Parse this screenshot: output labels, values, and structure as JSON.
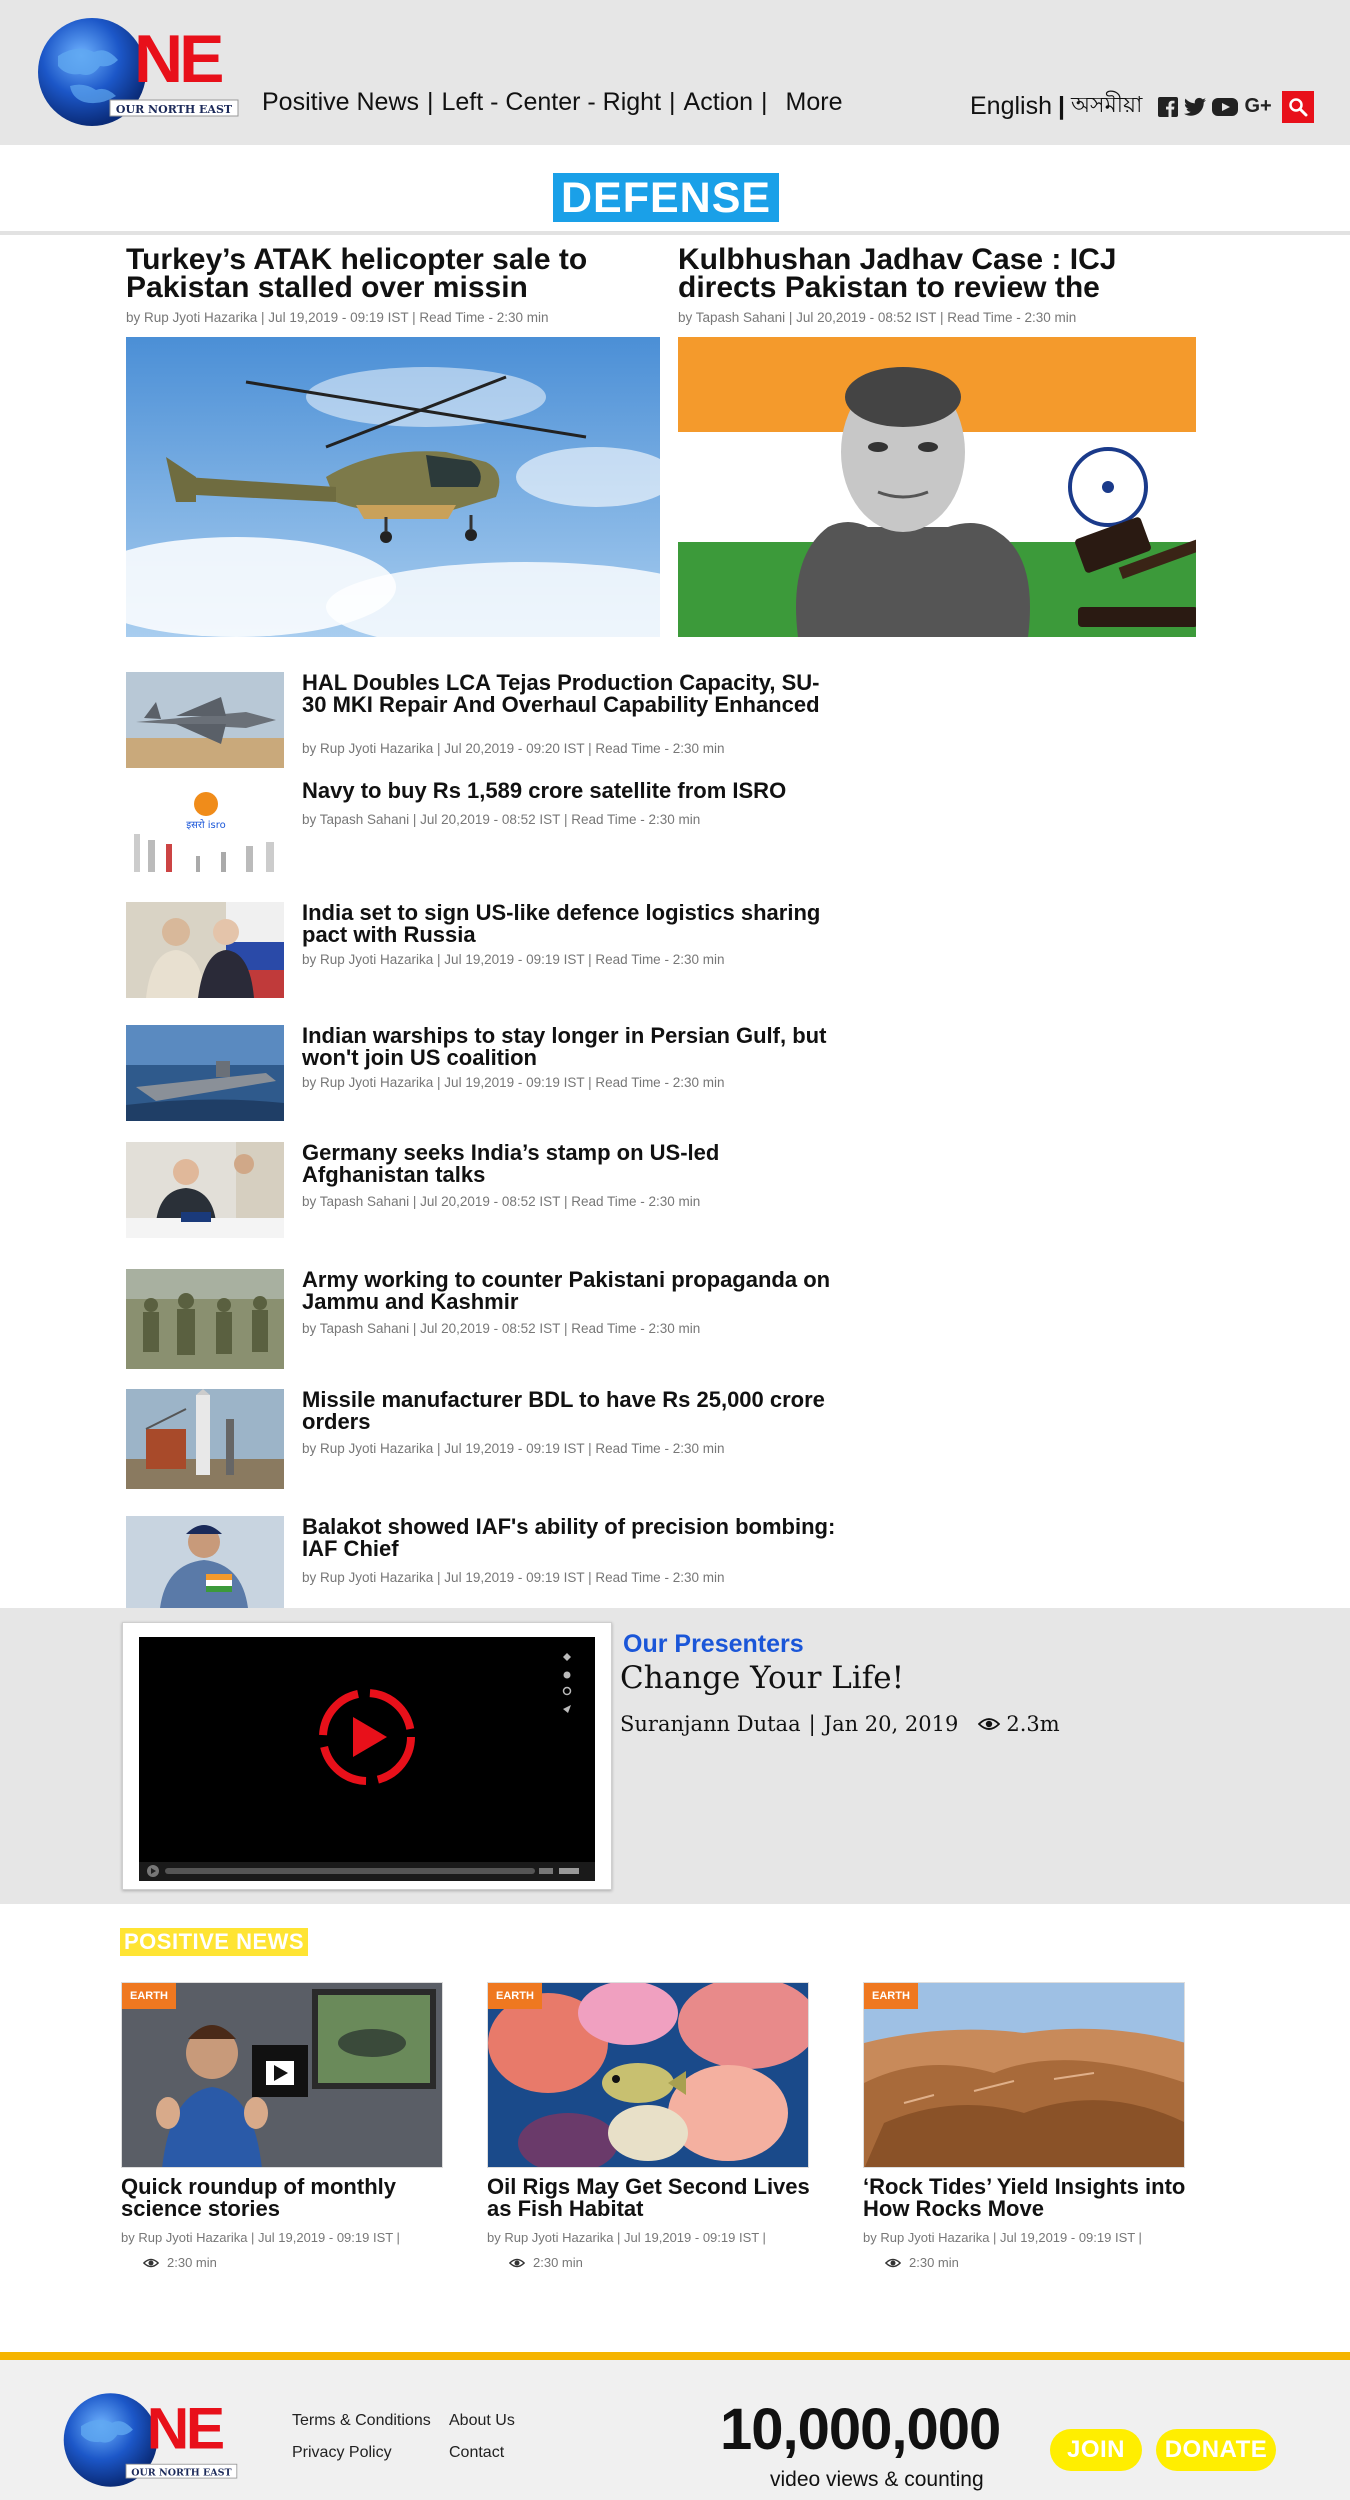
{
  "brand": {
    "logo_text": "ONE",
    "logo_subtext": "OUR NORTH EAST",
    "accent_red": "#e8101a",
    "globe_blue": "#1c57c8"
  },
  "nav": {
    "items": [
      "Positive News",
      "Left - Center - Right",
      "Action"
    ],
    "separator": "|",
    "more_label": "More",
    "lang_english": "English",
    "lang_separator": "|",
    "lang_assamese": "অসমীয়া",
    "social_icons": [
      "facebook-icon",
      "twitter-icon",
      "youtube-icon",
      "google-plus-icon"
    ],
    "google_plus_label": "G+"
  },
  "section": {
    "title": "DEFENSE",
    "title_bg": "#1aa0e8"
  },
  "top_stories": [
    {
      "title": "Turkey’s ATAK helicopter sale to Pakistan stalled over missin",
      "meta": "by Rup Jyoti Hazarika | Jul 19,2019 - 09:19 IST  | Read Time - 2:30 min",
      "image": "attack-helicopter-photo"
    },
    {
      "title": "Kulbhushan Jadhav Case : ICJ directs Pakistan to review the",
      "meta": "by Tapash Sahani | Jul 20,2019 - 08:52 IST | Read Time - 2:30 min",
      "image": "kulbhushan-jadhav-photo"
    }
  ],
  "stories": [
    {
      "title": "HAL Doubles LCA Tejas Production Capacity, SU-30 MKI Repair And Overhaul Capability Enhanced",
      "meta": "by Rup Jyoti Hazarika | Jul 20,2019  - 09:20 IST | Read Time - 2:30 min"
    },
    {
      "title": "Navy to buy Rs 1,589 crore satellite from ISRO",
      "meta": "by Tapash Sahani | Jul 20,2019 - 08:52 IST | Read Time - 2:30 min"
    },
    {
      "title": "India set to sign US-like defence logistics sharing pact with Russia",
      "meta": "by Rup Jyoti Hazarika | Jul 19,2019 - 09:19 IST  | Read Time - 2:30 min"
    },
    {
      "title": "Indian warships to stay longer in Persian Gulf, but won't join US coalition",
      "meta": "by Rup Jyoti Hazarika | Jul 19,2019 - 09:19 IST  | Read Time - 2:30 min"
    },
    {
      "title": "Germany seeks India’s stamp on US-led Afghanistan talks",
      "meta": "by Tapash Sahani | Jul 20,2019 - 08:52 IST | Read Time - 2:30 min"
    },
    {
      "title": "Army working to counter Pakistani propaganda on Jammu and Kashmir",
      "meta": "by Tapash Sahani | Jul 20,2019 - 08:52 IST | Read Time - 2:30 min"
    },
    {
      "title": "Missile manufacturer BDL to have Rs 25,000 crore orders",
      "meta": "by Rup Jyoti Hazarika | Jul 19,2019 - 09:19 IST  | Read Time - 2:30 min"
    },
    {
      "title": "Balakot showed IAF's ability of precision bombing: IAF Chief",
      "meta": "by Rup Jyoti Hazarika | Jul 19,2019 - 09:19 IST  | Read Time - 2:30 min"
    }
  ],
  "presenters": {
    "heading": "Our Presenters",
    "title": "Change Your Life!",
    "presenter": "Suranjann Dutaa",
    "separator": "|",
    "date": "Jan 20, 2019",
    "views": "2.3m"
  },
  "positive_news": {
    "heading": "POSITIVE NEWS",
    "cards": [
      {
        "tag": "EARTH",
        "title": "Quick roundup of monthly science stories",
        "meta": "by Rup Jyoti Hazarika | Jul 19,2019 - 09:19 IST  |",
        "read_time": "2:30 min"
      },
      {
        "tag": "EARTH",
        "title": "Oil Rigs May Get Second Lives as Fish Habitat",
        "meta": "by Rup Jyoti Hazarika | Jul 19,2019 - 09:19 IST  |",
        "read_time": "2:30 min"
      },
      {
        "tag": "EARTH",
        "title": "‘Rock Tides’ Yield Insights into How Rocks Move",
        "meta": "by Rup Jyoti Hazarika | Jul 19,2019 - 09:19 IST  |",
        "read_time": "2:30 min"
      }
    ]
  },
  "footer": {
    "links": [
      "Terms & Conditions",
      "About Us",
      "Privacy Policy",
      "Contact"
    ],
    "counter": "10,000,000",
    "counter_caption": "video views & counting",
    "join_label": "JOIN",
    "donate_label": "DONATE",
    "accent_yellow": "#f5b400"
  }
}
